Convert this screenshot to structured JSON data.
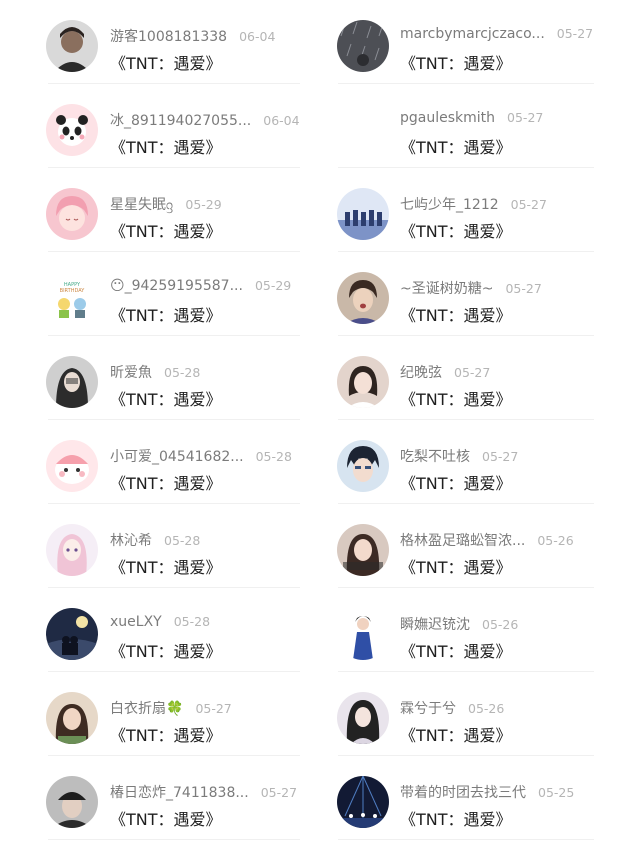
{
  "left": [
    {
      "user": "游客1008181338",
      "date": "06-04",
      "title": "《TNT：遇爱》",
      "avatar": "avatar-man-portrait"
    },
    {
      "user": "冰_891194027055...",
      "date": "06-04",
      "title": "《TNT：遇爱》",
      "avatar": "avatar-panda-cartoon"
    },
    {
      "user": "星星失眠ᦋ",
      "date": "05-29",
      "title": "《TNT：遇爱》",
      "avatar": "avatar-anime-girl"
    },
    {
      "user": "😶_94259195587...",
      "date": "05-29",
      "title": "《TNT：遇爱》",
      "avatar": "avatar-birthday-sticker"
    },
    {
      "user": "昕爱魚",
      "date": "05-28",
      "title": "《TNT：遇爱》",
      "avatar": "avatar-girl-dark"
    },
    {
      "user": "小可爱_04541682...",
      "date": "05-28",
      "title": "《TNT：遇爱》",
      "avatar": "avatar-pink-blob"
    },
    {
      "user": "林沁希",
      "date": "05-28",
      "title": "《TNT：遇爱》",
      "avatar": "avatar-anime-pink-hair"
    },
    {
      "user": "xueLXY",
      "date": "05-28",
      "title": "《TNT：遇爱》",
      "avatar": "avatar-night-couple"
    },
    {
      "user": "白衣折扇🍀",
      "date": "05-27",
      "title": "《TNT：遇爱》",
      "avatar": "avatar-girl-green"
    },
    {
      "user": "椿日恋炸_7411838...",
      "date": "05-27",
      "title": "《TNT：遇爱》",
      "avatar": "avatar-boy-hat"
    }
  ],
  "right": [
    {
      "user": "marcbymarcjczaco...",
      "date": "05-27",
      "title": "《TNT：遇爱》",
      "avatar": "avatar-rain-gray"
    },
    {
      "user": "pgauleskmith",
      "date": "05-27",
      "title": "《TNT：遇爱》",
      "avatar": "none"
    },
    {
      "user": "七屿少年_1212",
      "date": "05-27",
      "title": "《TNT：遇爱》",
      "avatar": "avatar-group-blue"
    },
    {
      "user": "~圣诞树奶糖~",
      "date": "05-27",
      "title": "《TNT：遇爱》",
      "avatar": "avatar-boy-singing"
    },
    {
      "user": "纪晚弦",
      "date": "05-27",
      "title": "《TNT：遇爱》",
      "avatar": "avatar-girl-bob"
    },
    {
      "user": "吃梨不吐核",
      "date": "05-27",
      "title": "《TNT：遇爱》",
      "avatar": "avatar-anime-boy"
    },
    {
      "user": "格林盈足璐蚣智浓...",
      "date": "05-26",
      "title": "《TNT：遇爱》",
      "avatar": "avatar-girl-text"
    },
    {
      "user": "瞬嫵迟铳沈",
      "date": "05-26",
      "title": "《TNT：遇爱》",
      "avatar": "avatar-woman-blue-dress"
    },
    {
      "user": "霖兮于兮",
      "date": "05-26",
      "title": "《TNT：遇爱》",
      "avatar": "avatar-girl-long-hair"
    },
    {
      "user": "带着的时团去找三代",
      "date": "05-25",
      "title": "《TNT：遇爱》",
      "avatar": "avatar-stage-lights"
    }
  ]
}
